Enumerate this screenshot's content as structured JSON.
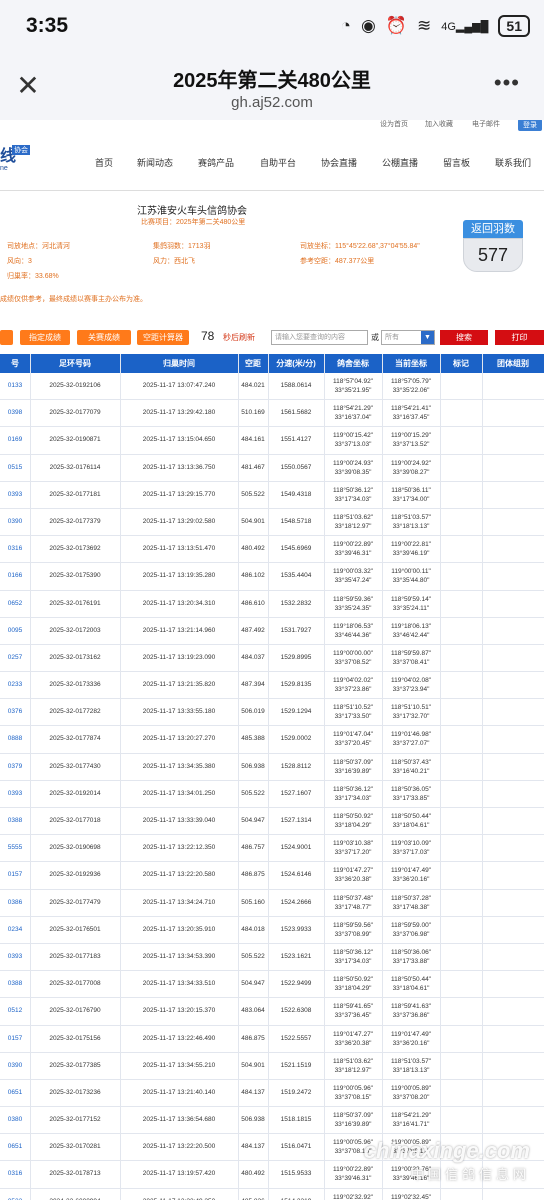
{
  "status": {
    "time": "3:35",
    "battery": "51",
    "signal": "4G"
  },
  "browser": {
    "title": "2025年第二关480公里",
    "url": "gh.aj52.com"
  },
  "top_links": [
    "设为首页",
    "加入收藏",
    "电子邮件"
  ],
  "login": "登录",
  "logo": {
    "text": "线",
    "tag": "协会",
    "sub": "ne"
  },
  "nav": [
    "首页",
    "新闻动态",
    "赛鸽产品",
    "自助平台",
    "协会直播",
    "公棚直播",
    "留言板",
    "联系我们"
  ],
  "info": {
    "association": "江苏淮安火车头信鸽协会",
    "race_label": "比赛项目：2025年第二关480公里",
    "release_place_label": "司放地点：",
    "release_place": "河北清河",
    "feathers_label": "集鸽羽数：",
    "feathers": "1713羽",
    "release_coord_label": "司放坐标：",
    "release_coord": "115°45'22.68\",37°04'55.84\"",
    "wind_dir_label": "风向：",
    "wind_dir": "3",
    "wind_label": "风力：",
    "wind": "西北飞",
    "ref_dist_label": "参考空距：",
    "ref_dist": "487.377公里",
    "return_rate_label": "归巢率：",
    "return_rate": "33.68%",
    "return_title": "返回羽数",
    "return_count": "577",
    "notice": "成绩仅供参考，最终成绩以赛事主办公布为准。"
  },
  "toolbar": {
    "btn0": "",
    "btn1": "指定成绩",
    "btn2": "关赛成绩",
    "btn3": "空距计算器",
    "count": "78",
    "refresh": "秒后刷新",
    "search_placeholder": "请输入您要查询的内容",
    "or": "或",
    "select": "所有",
    "search": "搜索",
    "print": "打印"
  },
  "table": {
    "headers": [
      "号",
      "足环号码",
      "归巢时间",
      "空距",
      "分速(米/分)",
      "鸽舍坐标",
      "当前坐标",
      "标记",
      "团体组别"
    ],
    "rows": [
      [
        "0133",
        "2025-32-0192106",
        "2025-11-17 13:07:47.240",
        "484.021",
        "1588.0614",
        "118°57'04.92\"|33°35'21.95\"",
        "118°57'05.79\"|33°35'22.06\""
      ],
      [
        "0398",
        "2025-32-0177079",
        "2025-11-17 13:29:42.180",
        "510.169",
        "1561.5682",
        "118°54'21.29\"|33°16'37.04\"",
        "118°54'21.41\"|33°16'37.45\""
      ],
      [
        "0169",
        "2025-32-0190871",
        "2025-11-17 13:15:04.650",
        "484.161",
        "1551.4127",
        "119°00'15.42\"|33°37'13.03\"",
        "119°00'15.29\"|33°37'13.52\""
      ],
      [
        "0515",
        "2025-32-0176114",
        "2025-11-17 13:13:36.750",
        "481.467",
        "1550.0567",
        "119°00'24.93\"|33°39'08.35\"",
        "119°00'24.92\"|33°39'08.27\""
      ],
      [
        "0393",
        "2025-32-0177181",
        "2025-11-17 13:29:15.770",
        "505.522",
        "1549.4318",
        "118°50'36.12\"|33°17'34.03\"",
        "118°50'36.11\"|33°17'34.00\""
      ],
      [
        "0390",
        "2025-32-0177379",
        "2025-11-17 13:29:02.580",
        "504.901",
        "1548.5718",
        "118°51'03.62\"|33°18'12.97\"",
        "118°51'03.57\"|33°18'13.13\""
      ],
      [
        "0316",
        "2025-32-0173692",
        "2025-11-17 13:13:51.470",
        "480.492",
        "1545.6969",
        "119°00'22.89\"|33°39'46.31\"",
        "119°00'22.81\"|33°39'46.19\""
      ],
      [
        "0166",
        "2025-32-0175390",
        "2025-11-17 13:19:35.280",
        "486.102",
        "1535.4404",
        "119°00'03.32\"|33°35'47.24\"",
        "119°00'00.11\"|33°35'44.80\""
      ],
      [
        "0652",
        "2025-32-0176191",
        "2025-11-17 13:20:34.310",
        "486.610",
        "1532.2832",
        "118°59'59.36\"|33°35'24.35\"",
        "118°59'59.14\"|33°35'24.11\""
      ],
      [
        "0095",
        "2025-32-0172003",
        "2025-11-17 13:21:14.960",
        "487.492",
        "1531.7927",
        "119°18'06.53\"|33°46'44.36\"",
        "119°18'06.13\"|33°46'42.44\""
      ],
      [
        "0257",
        "2025-32-0173162",
        "2025-11-17 13:19:23.090",
        "484.037",
        "1529.8995",
        "119°00'00.00\"|33°37'08.52\"",
        "118°59'59.87\"|33°37'08.41\""
      ],
      [
        "0233",
        "2025-32-0173336",
        "2025-11-17 13:21:35.820",
        "487.394",
        "1529.8135",
        "119°04'02.02\"|33°37'23.86\"",
        "119°04'02.08\"|33°37'23.94\""
      ],
      [
        "0376",
        "2025-32-0177282",
        "2025-11-17 13:33:55.180",
        "506.019",
        "1529.1294",
        "118°51'10.52\"|33°17'33.50\"",
        "118°51'10.51\"|33°17'32.70\""
      ],
      [
        "0888",
        "2025-32-0177874",
        "2025-11-17 13:20:27.270",
        "485.388",
        "1529.0002",
        "119°01'47.04\"|33°37'20.45\"",
        "119°01'46.98\"|33°37'27.07\""
      ],
      [
        "0379",
        "2025-32-0177430",
        "2025-11-17 13:34:35.380",
        "506.938",
        "1528.8112",
        "118°50'37.09\"|33°16'39.89\"",
        "118°50'37.43\"|33°16'40.21\""
      ],
      [
        "0393",
        "2025-32-0192014",
        "2025-11-17 13:34:01.250",
        "505.522",
        "1527.1607",
        "118°50'36.12\"|33°17'34.03\"",
        "118°50'36.05\"|33°17'33.85\""
      ],
      [
        "0388",
        "2025-32-0177018",
        "2025-11-17 13:33:39.040",
        "504.947",
        "1527.1314",
        "118°50'50.92\"|33°18'04.29\"",
        "118°50'50.44\"|33°18'04.61\""
      ],
      [
        "5555",
        "2025-32-0190698",
        "2025-11-17 13:22:12.350",
        "486.757",
        "1524.9001",
        "119°03'10.38\"|33°37'17.20\"",
        "119°03'10.09\"|33°37'17.03\""
      ],
      [
        "0157",
        "2025-32-0192936",
        "2025-11-17 13:22:20.580",
        "486.875",
        "1524.6146",
        "119°01'47.27\"|33°36'20.38\"",
        "119°01'47.49\"|33°36'20.16\""
      ],
      [
        "0386",
        "2025-32-0177479",
        "2025-11-17 13:34:24.710",
        "505.160",
        "1524.2666",
        "118°50'37.48\"|33°17'48.77\"",
        "118°50'37.28\"|33°17'48.38\""
      ],
      [
        "0234",
        "2025-32-0176501",
        "2025-11-17 13:20:35.910",
        "484.018",
        "1523.9933",
        "118°59'59.56\"|33°37'08.99\"",
        "118°59'59.00\"|33°37'06.98\""
      ],
      [
        "0393",
        "2025-32-0177183",
        "2025-11-17 13:34:53.390",
        "505.522",
        "1523.1621",
        "118°50'36.12\"|33°17'34.03\"",
        "118°50'36.06\"|33°17'33.88\""
      ],
      [
        "0388",
        "2025-32-0177008",
        "2025-11-17 13:34:33.510",
        "504.947",
        "1522.9499",
        "118°50'50.92\"|33°18'04.29\"",
        "118°50'50.44\"|33°18'04.61\""
      ],
      [
        "0512",
        "2025-32-0176790",
        "2025-11-17 13:20:15.370",
        "483.064",
        "1522.6308",
        "118°59'41.65\"|33°37'36.45\"",
        "118°59'41.63\"|33°37'36.86\""
      ],
      [
        "0157",
        "2025-32-0175156",
        "2025-11-17 13:22:46.490",
        "486.875",
        "1522.5557",
        "119°01'47.27\"|33°36'20.38\"",
        "119°01'47.49\"|33°36'20.16\""
      ],
      [
        "0390",
        "2025-32-0177385",
        "2025-11-17 13:34:55.210",
        "504.901",
        "1521.1519",
        "118°51'03.62\"|33°18'12.97\"",
        "118°51'03.57\"|33°18'13.13\""
      ],
      [
        "0651",
        "2025-32-0173236",
        "2025-11-17 13:21:40.140",
        "484.137",
        "1519.2472",
        "119°00'05.96\"|33°37'08.15\"",
        "119°00'05.89\"|33°37'08.20\""
      ],
      [
        "0380",
        "2025-32-0177152",
        "2025-11-17 13:36:54.680",
        "506.938",
        "1518.1815",
        "118°50'37.09\"|33°16'39.89\"",
        "118°54'21.29\"|33°16'41.71\""
      ],
      [
        "0651",
        "2025-32-0170281",
        "2025-11-17 13:22:20.500",
        "484.137",
        "1516.0471",
        "119°00'05.96\"|33°37'08.15\"",
        "119°00'05.89\"|33°37'08.17\""
      ],
      [
        "0316",
        "2025-32-0178713",
        "2025-11-17 13:19:57.420",
        "480.492",
        "1515.9533",
        "119°00'22.89\"|33°39'46.31\"",
        "119°00'22.76\"|33°39'46.16\""
      ],
      [
        "0522",
        "2024-32-6000994",
        "2025-11-17 13:23:49.250",
        "485.826",
        "1514.3219",
        "119°02'32.92\"|33°37'31.44\"",
        "119°02'32.45\"|33°37'31.45\""
      ],
      [
        "0376",
        "2025-32-0177213",
        "2025-11-17 13:38:29.240",
        "507.867",
        "1513.8187",
        "118°53'16.39\"|33°17'50.41\"",
        "118°53'15.83\"|33°17'50.60\""
      ]
    ]
  },
  "watermark": {
    "big": "chinaxinge.com",
    "small": "中国信鸽信息网"
  }
}
